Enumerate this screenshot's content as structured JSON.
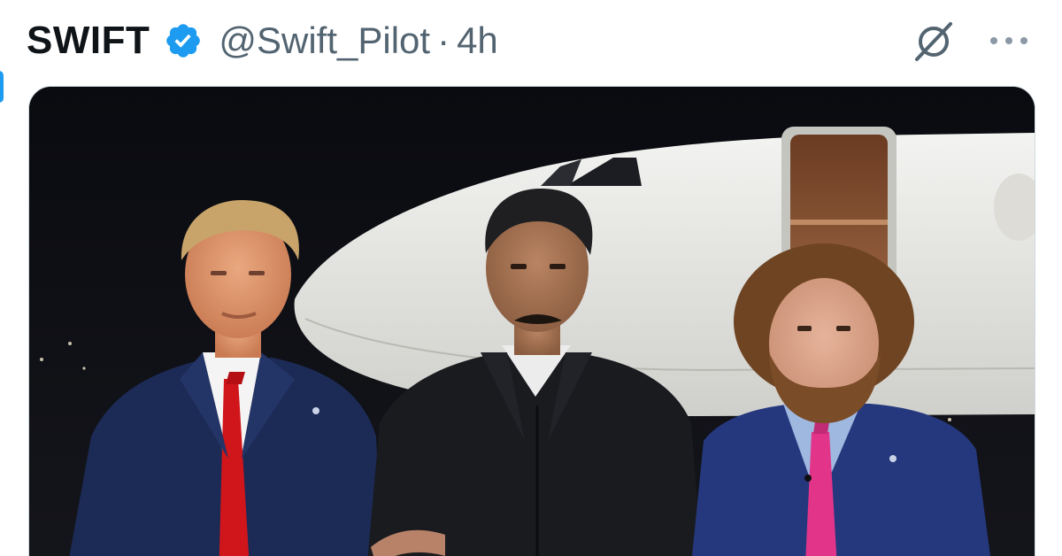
{
  "post": {
    "display_name": "SWIFT",
    "handle": "@Swift_Pilot",
    "separator": "·",
    "time": "4h",
    "verified_icon": "verified-badge-icon",
    "grok_icon": "grok-icon",
    "more_icon": "more-options-icon",
    "media": {
      "type": "photo",
      "alt": "Three men standing on a tarmac at night in front of a white private jet"
    }
  },
  "colors": {
    "verified": "#1d9bf0",
    "name": "#0f1419",
    "secondary_text": "#536471"
  }
}
